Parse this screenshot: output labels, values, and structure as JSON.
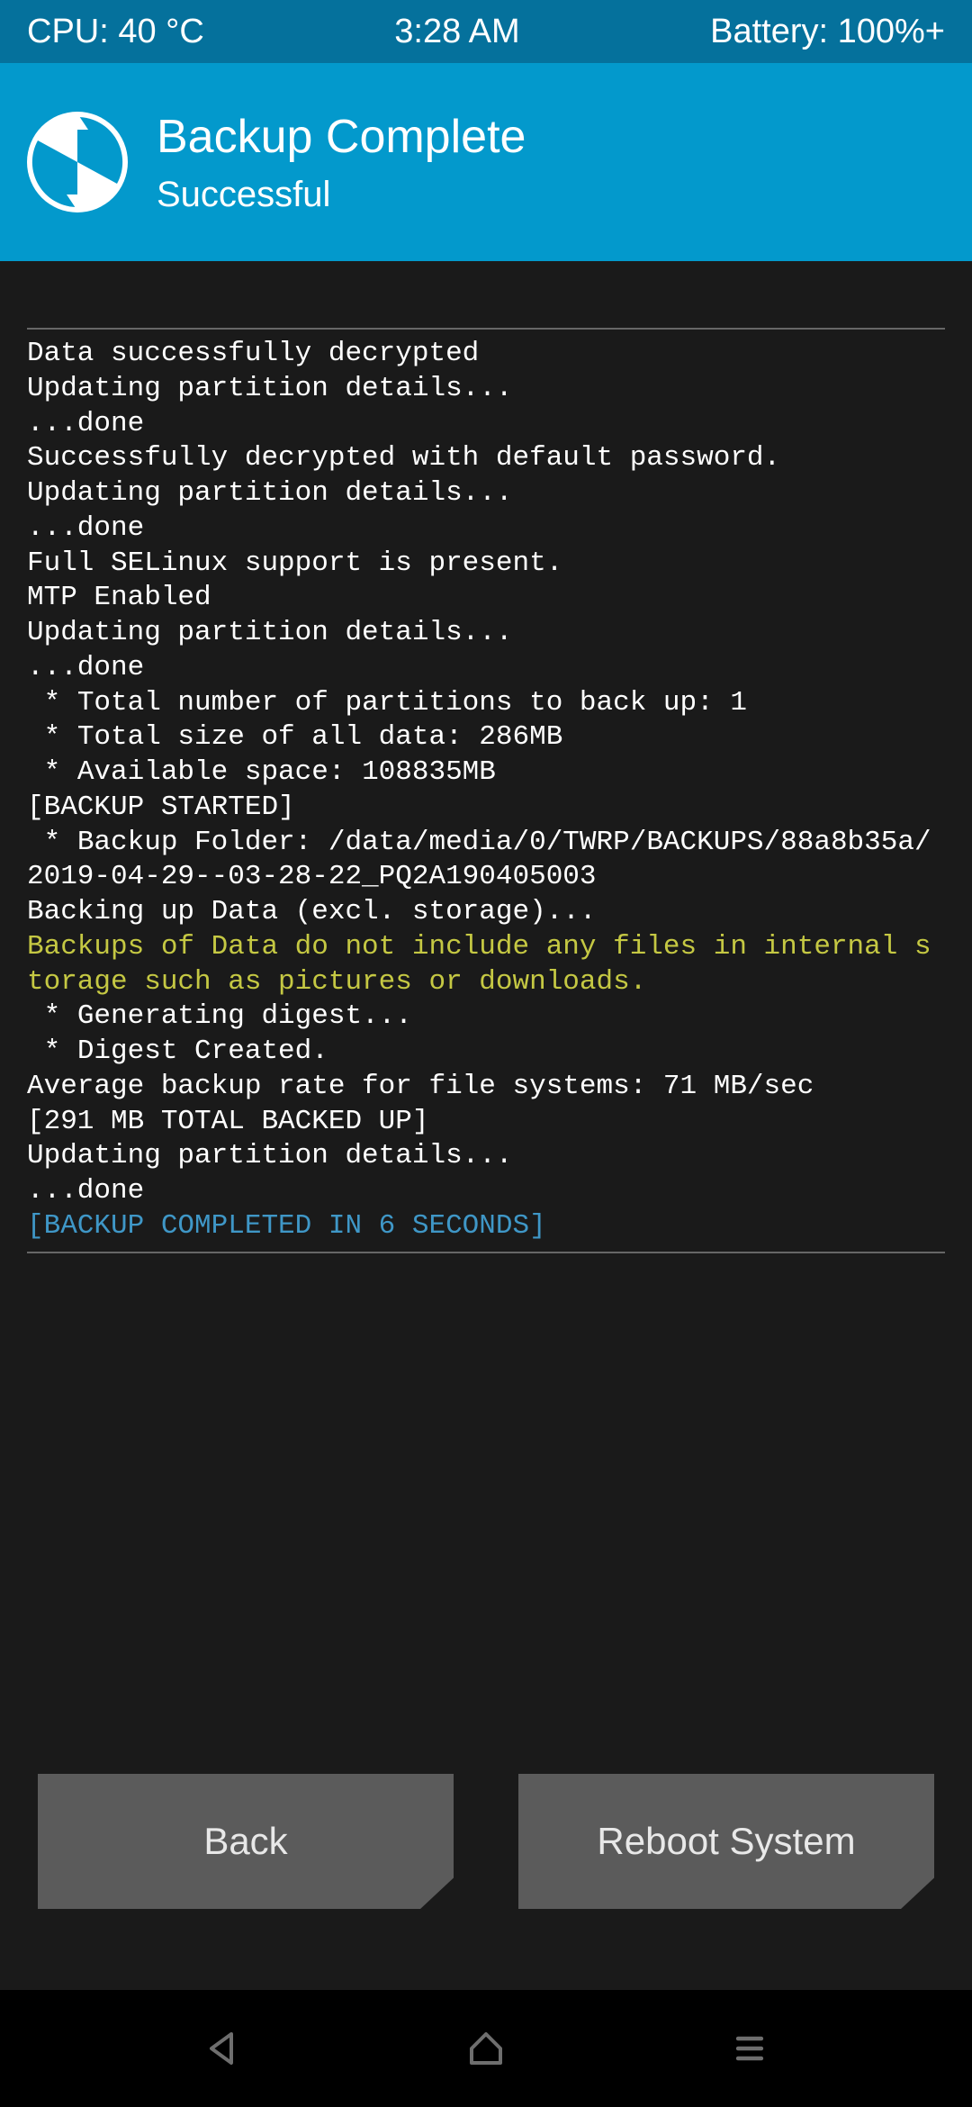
{
  "status_bar": {
    "cpu": "CPU: 40 °C",
    "time": "3:28 AM",
    "battery": "Battery: 100%+"
  },
  "header": {
    "title": "Backup Complete",
    "subtitle": "Successful"
  },
  "log_lines": [
    {
      "text": "Data successfully decrypted",
      "color": "white"
    },
    {
      "text": "Updating partition details...",
      "color": "white"
    },
    {
      "text": "...done",
      "color": "white"
    },
    {
      "text": "Successfully decrypted with default password.",
      "color": "white"
    },
    {
      "text": "Updating partition details...",
      "color": "white"
    },
    {
      "text": "...done",
      "color": "white"
    },
    {
      "text": "Full SELinux support is present.",
      "color": "white"
    },
    {
      "text": "MTP Enabled",
      "color": "white"
    },
    {
      "text": "Updating partition details...",
      "color": "white"
    },
    {
      "text": "...done",
      "color": "white"
    },
    {
      "text": " * Total number of partitions to back up: 1",
      "color": "white"
    },
    {
      "text": " * Total size of all data: 286MB",
      "color": "white"
    },
    {
      "text": " * Available space: 108835MB",
      "color": "white"
    },
    {
      "text": "[BACKUP STARTED]",
      "color": "white"
    },
    {
      "text": " * Backup Folder: /data/media/0/TWRP/BACKUPS/88a8b35a/2019-04-29--03-28-22_PQ2A190405003",
      "color": "white"
    },
    {
      "text": "Backing up Data (excl. storage)...",
      "color": "white"
    },
    {
      "text": "Backups of Data do not include any files in internal storage such as pictures or downloads.",
      "color": "yellow"
    },
    {
      "text": " * Generating digest...",
      "color": "white"
    },
    {
      "text": " * Digest Created.",
      "color": "white"
    },
    {
      "text": "Average backup rate for file systems: 71 MB/sec",
      "color": "white"
    },
    {
      "text": "[291 MB TOTAL BACKED UP]",
      "color": "white"
    },
    {
      "text": "Updating partition details...",
      "color": "white"
    },
    {
      "text": "...done",
      "color": "white"
    },
    {
      "text": "[BACKUP COMPLETED IN 6 SECONDS]",
      "color": "blue"
    }
  ],
  "buttons": {
    "back": "Back",
    "reboot": "Reboot System"
  }
}
